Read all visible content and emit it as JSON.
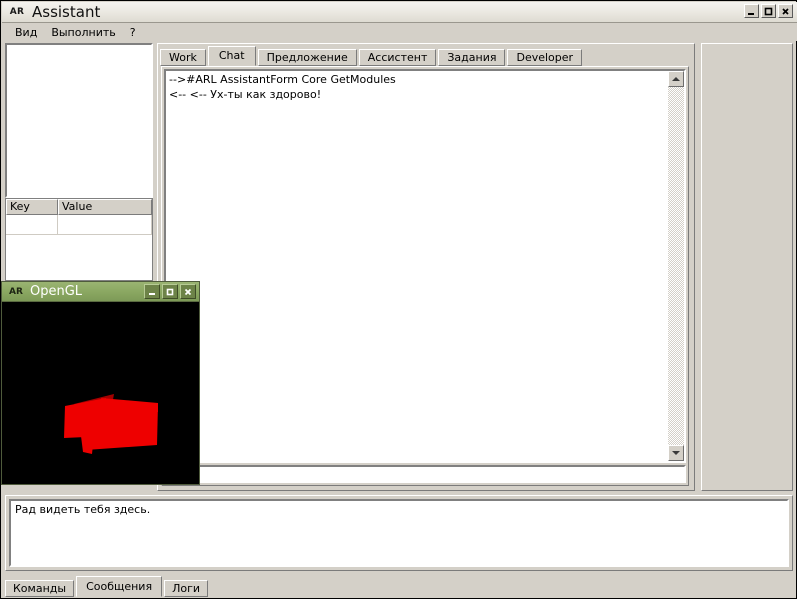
{
  "window": {
    "icon_label": "AR",
    "title": "Assistant",
    "controls": {
      "minimize": "minimize-icon",
      "maximize": "maximize-icon",
      "close": "close-icon"
    }
  },
  "menubar": {
    "items": [
      {
        "label": "Вид"
      },
      {
        "label": "Выполнить"
      },
      {
        "label": "?"
      }
    ]
  },
  "left_panel": {
    "list_items": [],
    "kv_table": {
      "columns": [
        "Key",
        "Value"
      ],
      "rows": [
        {
          "key": "",
          "value": ""
        }
      ]
    }
  },
  "main": {
    "tabs": [
      {
        "label": "Work",
        "active": false
      },
      {
        "label": "Chat",
        "active": true
      },
      {
        "label": "Предложение",
        "active": false
      },
      {
        "label": "Ассистент",
        "active": false
      },
      {
        "label": "Задания",
        "active": false
      },
      {
        "label": "Developer",
        "active": false
      }
    ],
    "chat": {
      "lines": [
        "-->#ARL AssistantForm Core GetModules",
        "<-- <-- Ух-ты как здорово!"
      ],
      "input_value": "",
      "scrollbar": {
        "up_icon": "arrow-up-icon",
        "down_icon": "arrow-down-icon"
      }
    }
  },
  "right_panel": {
    "content": ""
  },
  "bottom": {
    "message_text": "Рад видеть тебя здесь.",
    "tabs": [
      {
        "label": "Команды",
        "active": false
      },
      {
        "label": "Сообщения",
        "active": true
      },
      {
        "label": "Логи",
        "active": false
      }
    ]
  },
  "opengl_window": {
    "icon_label": "AR",
    "title": "OpenGL",
    "controls": {
      "minimize": "minimize-icon",
      "maximize": "maximize-icon",
      "close": "close-icon"
    },
    "canvas": {
      "background_color": "#000000",
      "shape_color": "#ee0000",
      "shape_shadow_color": "#a40000",
      "description": "red-3d-polygon"
    }
  },
  "colors": {
    "window_face": "#d4d0c8",
    "titlebar_start": "#f4f3ef",
    "gl_titlebar": "#8ba862",
    "text": "#000000"
  }
}
